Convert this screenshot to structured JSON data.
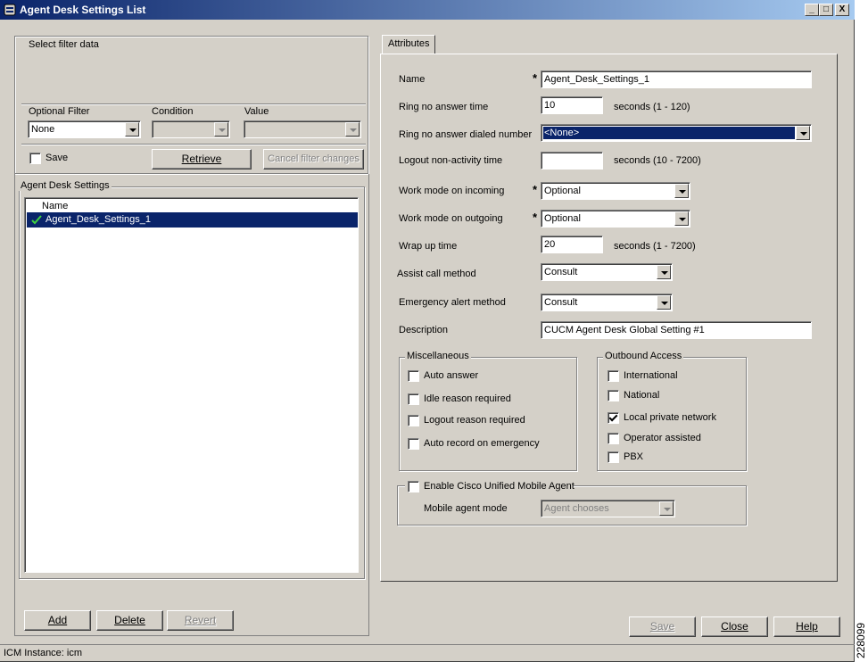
{
  "window": {
    "title": "Agent Desk Settings List",
    "min_glyph": "_",
    "max_glyph": "□",
    "close_glyph": "X"
  },
  "filter": {
    "group_label": "Select filter data",
    "optional_filter_label": "Optional Filter",
    "condition_label": "Condition",
    "value_label": "Value",
    "optional_filter_value": "None",
    "condition_value": "",
    "value_value": "",
    "save_label": "Save",
    "save_checked": false,
    "retrieve_label": "Retrieve",
    "cancel_label": "Cancel filter changes"
  },
  "list": {
    "group_label": "Agent Desk Settings",
    "column_header": "Name",
    "items": [
      {
        "name": "Agent_Desk_Settings_1",
        "selected": true
      }
    ]
  },
  "list_buttons": {
    "add": "Add",
    "delete": "Delete",
    "revert": "Revert"
  },
  "attributes": {
    "tab_label": "Attributes",
    "required_marker": "*",
    "name_label": "Name",
    "name_value": "Agent_Desk_Settings_1",
    "ring_no_answer_time_label": "Ring no answer time",
    "ring_no_answer_time_value": "10",
    "ring_no_answer_time_hint": "seconds (1 - 120)",
    "ring_no_answer_dn_label": "Ring no answer dialed number",
    "ring_no_answer_dn_value": "<None>",
    "logout_label": "Logout non-activity time",
    "logout_value": "",
    "logout_hint": "seconds (10 - 7200)",
    "work_incoming_label": "Work mode on incoming",
    "work_incoming_value": "Optional",
    "work_outgoing_label": "Work mode on outgoing",
    "work_outgoing_value": "Optional",
    "wrap_up_label": "Wrap up time",
    "wrap_up_value": "20",
    "wrap_up_hint": "seconds (1 - 7200)",
    "assist_label": "Assist call method",
    "assist_value": "Consult",
    "emergency_label": "Emergency alert method",
    "emergency_value": "Consult",
    "description_label": "Description",
    "description_value": "CUCM Agent Desk Global Setting #1"
  },
  "misc": {
    "group_label": "Miscellaneous",
    "items": [
      {
        "label": "Auto answer",
        "checked": false
      },
      {
        "label": "Idle reason required",
        "checked": false
      },
      {
        "label": "Logout reason required",
        "checked": false
      },
      {
        "label": "Auto record on emergency",
        "checked": false
      }
    ]
  },
  "outbound": {
    "group_label": "Outbound Access",
    "items": [
      {
        "label": "International",
        "checked": false
      },
      {
        "label": "National",
        "checked": false
      },
      {
        "label": "Local private network",
        "checked": true
      },
      {
        "label": "Operator assisted",
        "checked": false
      },
      {
        "label": "PBX",
        "checked": false
      }
    ]
  },
  "mobile": {
    "enable_label": "Enable Cisco Unified Mobile Agent",
    "enable_checked": false,
    "mode_label": "Mobile agent mode",
    "mode_value": "Agent chooses"
  },
  "footer_buttons": {
    "save": "Save",
    "close": "Close",
    "help": "Help"
  },
  "status": {
    "text": "ICM Instance: icm"
  },
  "figure_code": "228099",
  "colors": {
    "face": "#d4d0c8",
    "selection": "#0a246a",
    "title_gradient_start": "#0a246a",
    "title_gradient_end": "#a6caf0"
  }
}
